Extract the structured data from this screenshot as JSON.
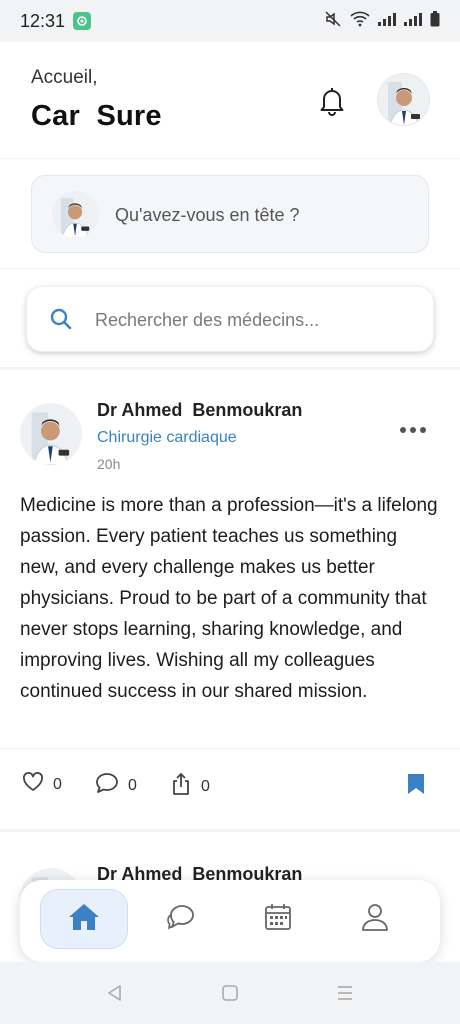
{
  "status_bar": {
    "time": "12:31",
    "icons": [
      "app-notification-icon",
      "mute-icon",
      "wifi-icon",
      "signal-icon",
      "signal-icon",
      "battery-icon"
    ]
  },
  "header": {
    "greeting": "Accueil,",
    "app_name": "Car  Sure",
    "icons": [
      "bell-icon",
      "avatar"
    ]
  },
  "compose": {
    "placeholder": "Qu'avez-vous en tête ?"
  },
  "search": {
    "placeholder": "Rechercher des médecins..."
  },
  "posts": [
    {
      "author": "Dr Ahmed  Benmoukran",
      "specialty": "Chirurgie cardiaque",
      "time": "20h",
      "text": "Medicine is more than a profession—it's a lifelong passion. Every patient teaches us something new, and every challenge makes us better physicians. Proud to be part of a community that never stops learning, sharing knowledge, and improving lives. Wishing all my colleagues continued success in our shared mission.",
      "likes": "0",
      "comments": "0",
      "shares": "0",
      "bookmarked": true
    },
    {
      "author": "Dr Ahmed  Benmoukran"
    }
  ],
  "bottom_nav": {
    "items": [
      {
        "icon": "home-icon",
        "active": true
      },
      {
        "icon": "chat-icon",
        "active": false
      },
      {
        "icon": "calendar-icon",
        "active": false
      },
      {
        "icon": "profile-icon",
        "active": false
      }
    ]
  },
  "system_nav": [
    "back-icon",
    "home-square-icon",
    "menu-icon"
  ],
  "colors": {
    "accent": "#3a82c4",
    "nav_active_bg": "#e7f0fb",
    "status_app": "#4cc38a"
  }
}
